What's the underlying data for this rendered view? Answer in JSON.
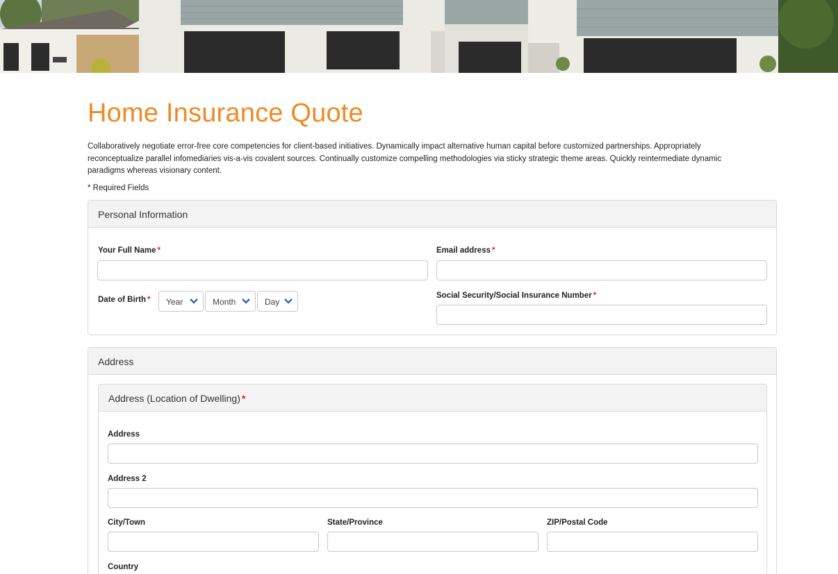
{
  "page": {
    "title": "Home Insurance Quote",
    "intro": "Collaboratively negotiate error-free core competencies for client-based initiatives. Dynamically impact alternative human capital before customized partnerships. Appropriately reconceptualize parallel infomediaries vis-a-vis covalent sources. Continually customize compelling methodologies via sticky strategic theme areas. Quickly reintermediate dynamic paradigms whereas visionary content.",
    "required_note": "* Required Fields"
  },
  "personal": {
    "heading": "Personal Information",
    "full_name_label": "Your Full Name",
    "email_label": "Email address",
    "dob_label": "Date of Birth",
    "ssn_label": "Social Security/Social Insurance Number",
    "year_select": "Year",
    "month_select": "Month",
    "day_select": "Day",
    "required_mark": "*"
  },
  "address": {
    "heading": "Address",
    "sub_heading": "Address (Location of Dwelling)",
    "address_label": "Address",
    "address2_label": "Address 2",
    "city_label": "City/Town",
    "state_label": "State/Province",
    "zip_label": "ZIP/Postal Code",
    "country_label": "Country",
    "required_mark": "*"
  },
  "colors": {
    "accent": "#f08a24",
    "required": "#e02020",
    "chevron": "#2a6db5"
  }
}
